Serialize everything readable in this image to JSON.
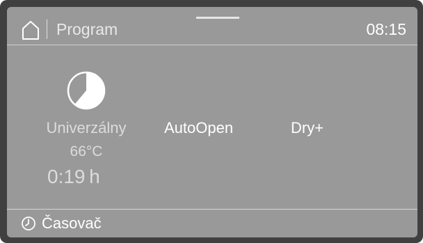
{
  "header": {
    "title": "Program",
    "time": "08:15",
    "home_icon": "home-icon"
  },
  "program": {
    "icon": "pie-chart-icon",
    "name": "Univerzálny",
    "temperature": "66°C",
    "duration": "0:19 h"
  },
  "options": [
    {
      "label": "AutoOpen"
    },
    {
      "label": "Dry+"
    }
  ],
  "footer": {
    "timer_icon": "clock-icon",
    "timer_label": "Časovač"
  },
  "colors": {
    "screen_bg": "#999999",
    "frame": "#404040",
    "text": "#ffffff",
    "muted_text": "#dcdcdc"
  }
}
